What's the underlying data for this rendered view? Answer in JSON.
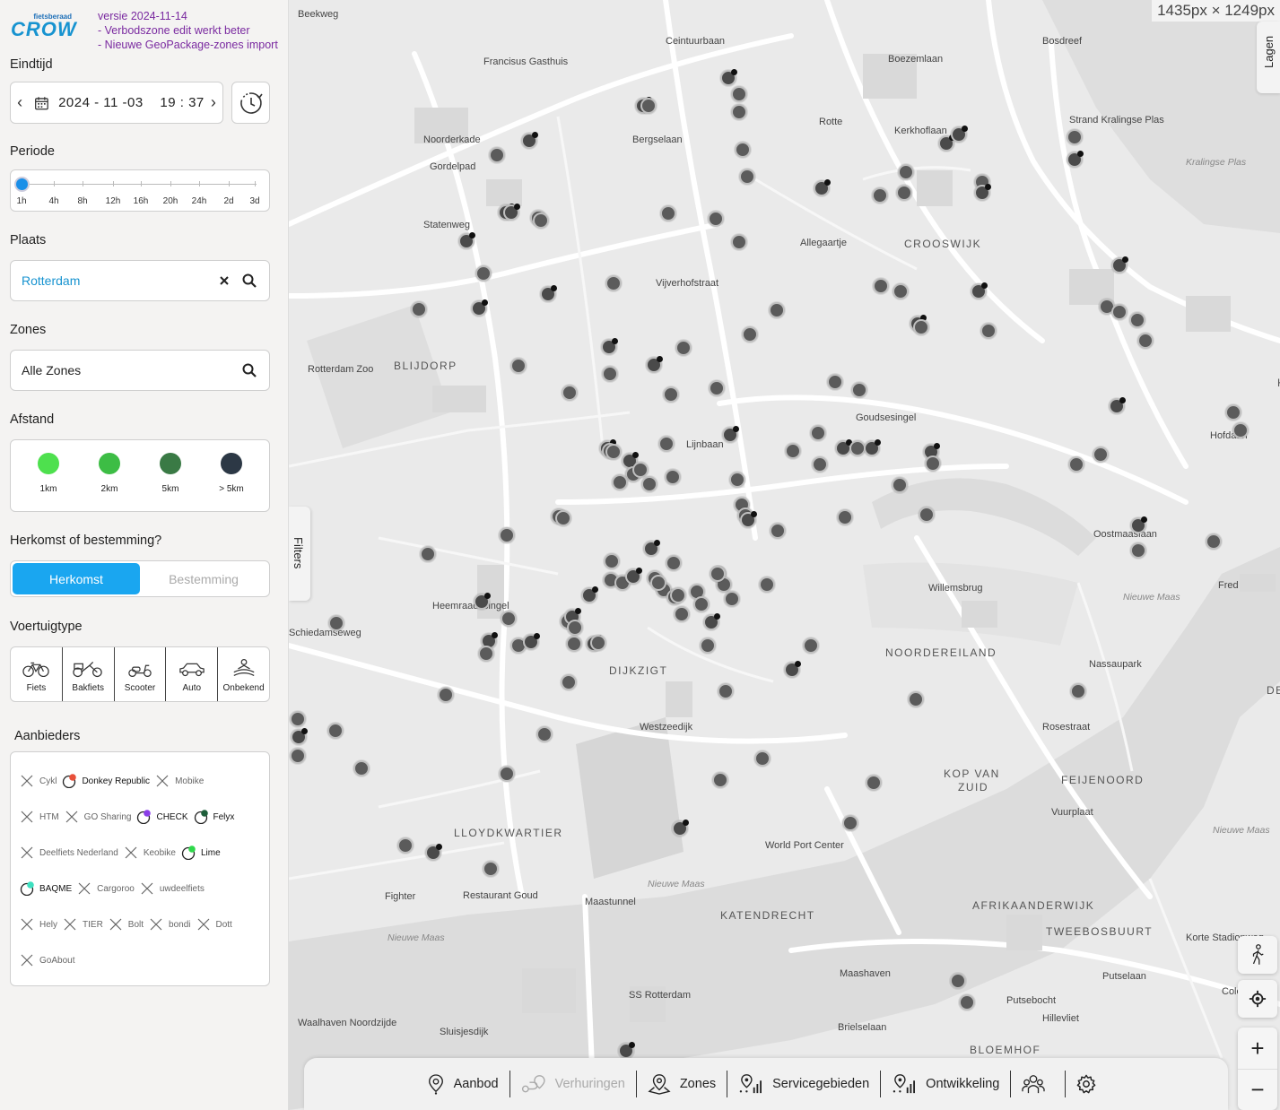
{
  "logo": {
    "small": "fietsberaad",
    "big": "CROW"
  },
  "version": {
    "line1": "versie 2024-11-14",
    "line2": "- Verbodszone edit werkt beter",
    "line3": "- Nieuwe GeoPackage-zones import"
  },
  "eindtijd": {
    "label": "Eindtijd",
    "prev": "‹",
    "next": "›",
    "value": "2024 - 11 -03    19 : 37"
  },
  "periode": {
    "label": "Periode",
    "ticks": [
      "1h",
      "4h",
      "8h",
      "12h",
      "16h",
      "20h",
      "24h",
      "2d",
      "3d"
    ],
    "selected_index": 0
  },
  "plaats": {
    "label": "Plaats",
    "value": "Rotterdam"
  },
  "zones": {
    "label": "Zones",
    "value": "Alle Zones"
  },
  "afstand": {
    "label": "Afstand",
    "items": [
      {
        "label": "1km",
        "color": "#4ee04e"
      },
      {
        "label": "2km",
        "color": "#3dbd45"
      },
      {
        "label": "5km",
        "color": "#3a7a45"
      },
      {
        "label": "> 5km",
        "color": "#2c3845"
      }
    ]
  },
  "herkomst": {
    "label": "Herkomst of bestemming?",
    "options": [
      "Herkomst",
      "Bestemming"
    ],
    "active": "Herkomst",
    "accent": "#1aa6f0"
  },
  "voertuigtype": {
    "label": "Voertuigtype",
    "items": [
      "Fiets",
      "Bakfiets",
      "Scooter",
      "Auto",
      "Onbekend"
    ]
  },
  "aanbieders": {
    "label": "Aanbieders",
    "rows": [
      [
        {
          "name": "Cykl",
          "on": false
        },
        {
          "name": "Donkey Republic",
          "on": true,
          "color": "#e8503a"
        },
        {
          "name": "Mobike",
          "on": false
        }
      ],
      [
        {
          "name": "HTM",
          "on": false
        },
        {
          "name": "GO Sharing",
          "on": false
        },
        {
          "name": "CHECK",
          "on": true,
          "color": "#8a3ee8"
        },
        {
          "name": "Felyx",
          "on": true,
          "color": "#1d5e3a"
        }
      ],
      [
        {
          "name": "Deelfiets Nederland",
          "on": false
        },
        {
          "name": "Keobike",
          "on": false
        },
        {
          "name": "Lime",
          "on": true,
          "color": "#2ed84a"
        }
      ],
      [
        {
          "name": "BAQME",
          "on": true,
          "color": "#3ee0c0"
        },
        {
          "name": "Cargoroo",
          "on": false
        },
        {
          "name": "uwdeelfiets",
          "on": false
        }
      ],
      [
        {
          "name": "Hely",
          "on": false
        },
        {
          "name": "TIER",
          "on": false
        },
        {
          "name": "Bolt",
          "on": false
        },
        {
          "name": "bondi",
          "on": false
        },
        {
          "name": "Dott",
          "on": false
        }
      ],
      [
        {
          "name": "GoAbout",
          "on": false
        }
      ]
    ]
  },
  "map": {
    "dimensions": "1435px × 1249px",
    "lagen": "Lagen",
    "filters": "Filters",
    "labels": [
      "Francisus Gasthuis",
      "Strand Kralingse Plas",
      "Allegaartje",
      "CROOSWIJK",
      "Rotterdam Zoo",
      "BLIJDORP",
      "KRALINGEN",
      "Willemsbrug",
      "NOORDEREILAND",
      "DIJKZIGT",
      "KOP VAN",
      "ZUID",
      "FEIJENOORD",
      "LLOYDKWARTIER",
      "World Port Center",
      "Fighter",
      "Restaurant Goud",
      "KATENDRECHT",
      "AFRIKAANDERWIJK",
      "TWEEBOSBUURT",
      "SS Rotterdam",
      "BLOEMHOF",
      "Fred",
      "DE",
      "Ceintuurbaan",
      "Boezemlaan",
      "Bosdreef",
      "Noorderkade",
      "Gordelpad",
      "Bergselaan",
      "Rotte",
      "Kerkhoflaan",
      "Statenweg",
      "Vijverhofstraat",
      "Goudsesingel",
      "Lijnbaan",
      "Oostmaaslaan",
      "Hofdaan",
      "Heemraadssingel",
      "Westzeedijk",
      "Nassaupark",
      "Rosestraat",
      "Vuurplaat",
      "Maastunnel",
      "Maashaven",
      "Putselaan",
      "Putsebocht",
      "Hillevliet",
      "Brielselaan",
      "Sluisjesdijk",
      "Waalhaven Noordzijde",
      "Korte Stadionweg",
      "Colosseum",
      "Beekweg",
      "Schiedamseweg"
    ],
    "water_labels": [
      "Kralingse Plas",
      "Nieuwe Maas",
      "Nieuwe Maas",
      "Nieuwe Maas",
      "Nieuwe Maas"
    ]
  },
  "controls": {
    "walk_icon": "walk-icon",
    "locate_icon": "locate-icon",
    "zoom_in": "+",
    "zoom_out": "−"
  },
  "bottom_nav": [
    {
      "label": "Aanbod",
      "icon": "pin-dot-icon",
      "disabled": false
    },
    {
      "label": "Verhuringen",
      "icon": "route-icon",
      "disabled": true
    },
    {
      "label": "Zones",
      "icon": "zone-pin-icon",
      "disabled": false
    },
    {
      "label": "Servicegebieden",
      "icon": "pin-bars-icon",
      "disabled": false
    },
    {
      "label": "Ontwikkeling",
      "icon": "pin-bars-icon",
      "disabled": false
    },
    {
      "label": "",
      "icon": "users-icon",
      "disabled": false
    },
    {
      "label": "",
      "icon": "gear-icon",
      "disabled": false
    }
  ]
}
